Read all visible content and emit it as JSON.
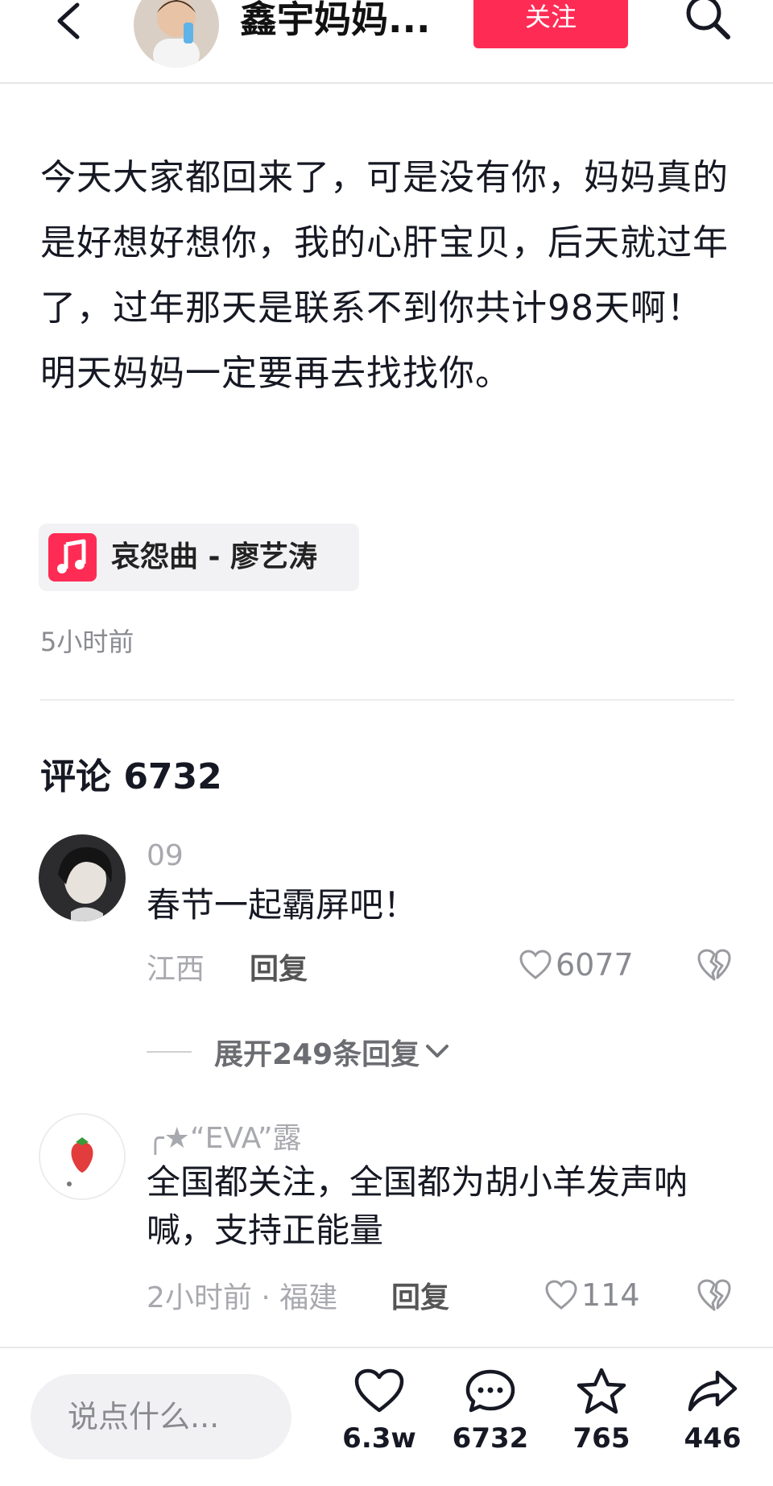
{
  "header": {
    "author_name": "鑫宇妈妈...",
    "follow_label": "关注"
  },
  "post": {
    "text": "今天大家都回来了，可是没有你，妈妈真的是好想好想你，我的心肝宝贝，后天就过年了，过年那天是联系不到你共计98天啊！明天妈妈一定要再去找找你。",
    "music": "哀怨曲 - 廖艺涛",
    "time": "5小时前"
  },
  "comments": {
    "title": "评论 6732",
    "items": [
      {
        "user": "09",
        "text": "春节一起霸屏吧！",
        "meta": "江西",
        "reply_label": "回复",
        "likes": "6077"
      },
      {
        "user": "╭★“EVA”露",
        "text": "全国都关注，全国都为胡小羊发声呐喊，支持正能量",
        "meta": "2小时前 · 福建",
        "reply_label": "回复",
        "likes": "114"
      }
    ],
    "expand_label": "展开249条回复"
  },
  "bottom_bar": {
    "input_placeholder": "说点什么...",
    "like_count": "6.3w",
    "comment_count": "6732",
    "favorite_count": "765",
    "share_count": "446"
  },
  "colors": {
    "accent": "#fe2c55",
    "text_primary": "#161823",
    "text_secondary": "#a8a9ae"
  }
}
